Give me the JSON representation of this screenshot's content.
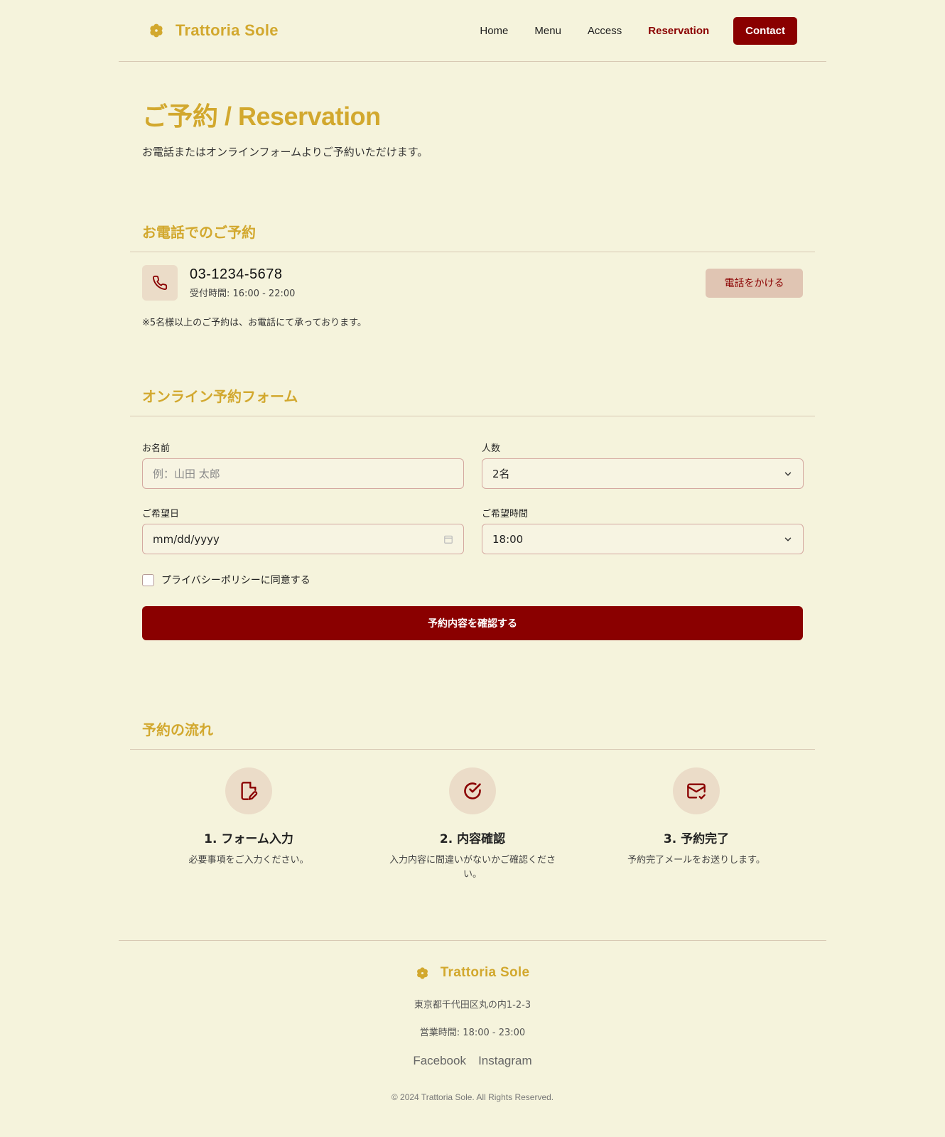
{
  "brand": {
    "name": "Trattoria Sole",
    "color": "#d2a82e",
    "logo_icon": "flower-icon"
  },
  "nav": {
    "items": [
      {
        "label": "Home"
      },
      {
        "label": "Menu"
      },
      {
        "label": "Access"
      },
      {
        "label": "Reservation",
        "active": true
      }
    ],
    "contact_label": "Contact"
  },
  "page": {
    "title": "ご予約 / Reservation",
    "lead": "お電話またはオンラインフォームよりご予約いただけます。"
  },
  "phone_section": {
    "title": "お電話でのご予約",
    "icon": "phone-icon",
    "number": "03-1234-5678",
    "hours": "受付時間: 16:00 - 22:00",
    "call_button": "電話をかける",
    "note": "※5名様以上のご予約は、お電話にて承っております。"
  },
  "form_section": {
    "title": "オンライン予約フォーム",
    "name": {
      "label": "お名前",
      "placeholder": "例：山田 太郎"
    },
    "guests": {
      "label": "人数",
      "value": "2名"
    },
    "date": {
      "label": "ご希望日",
      "placeholder": "mm/dd/yyyy"
    },
    "time": {
      "label": "ご希望時間",
      "value": "18:00"
    },
    "privacy_label": "プライバシーポリシーに同意する",
    "submit_label": "予約内容を確認する"
  },
  "flow_section": {
    "title": "予約の流れ",
    "steps": [
      {
        "title": "1. フォーム入力",
        "desc": "必要事項をご入力ください。",
        "icon": "document-edit-icon"
      },
      {
        "title": "2. 内容確認",
        "desc": "入力内容に間違いがないかご確認ください。",
        "icon": "check-circle-icon"
      },
      {
        "title": "3. 予約完了",
        "desc": "予約完了メールをお送りします。",
        "icon": "mail-check-icon"
      }
    ]
  },
  "footer": {
    "name": "Trattoria Sole",
    "address": "東京都千代田区丸の内1-2-3",
    "hours": "営業時間: 18:00 - 23:00",
    "links": [
      "Facebook",
      "Instagram"
    ],
    "copyright": "© 2024 Trattoria Sole. All Rights Reserved."
  },
  "colors": {
    "accent": "#8a0000",
    "background": "#f5f3dc",
    "gold": "#d2a82e"
  }
}
